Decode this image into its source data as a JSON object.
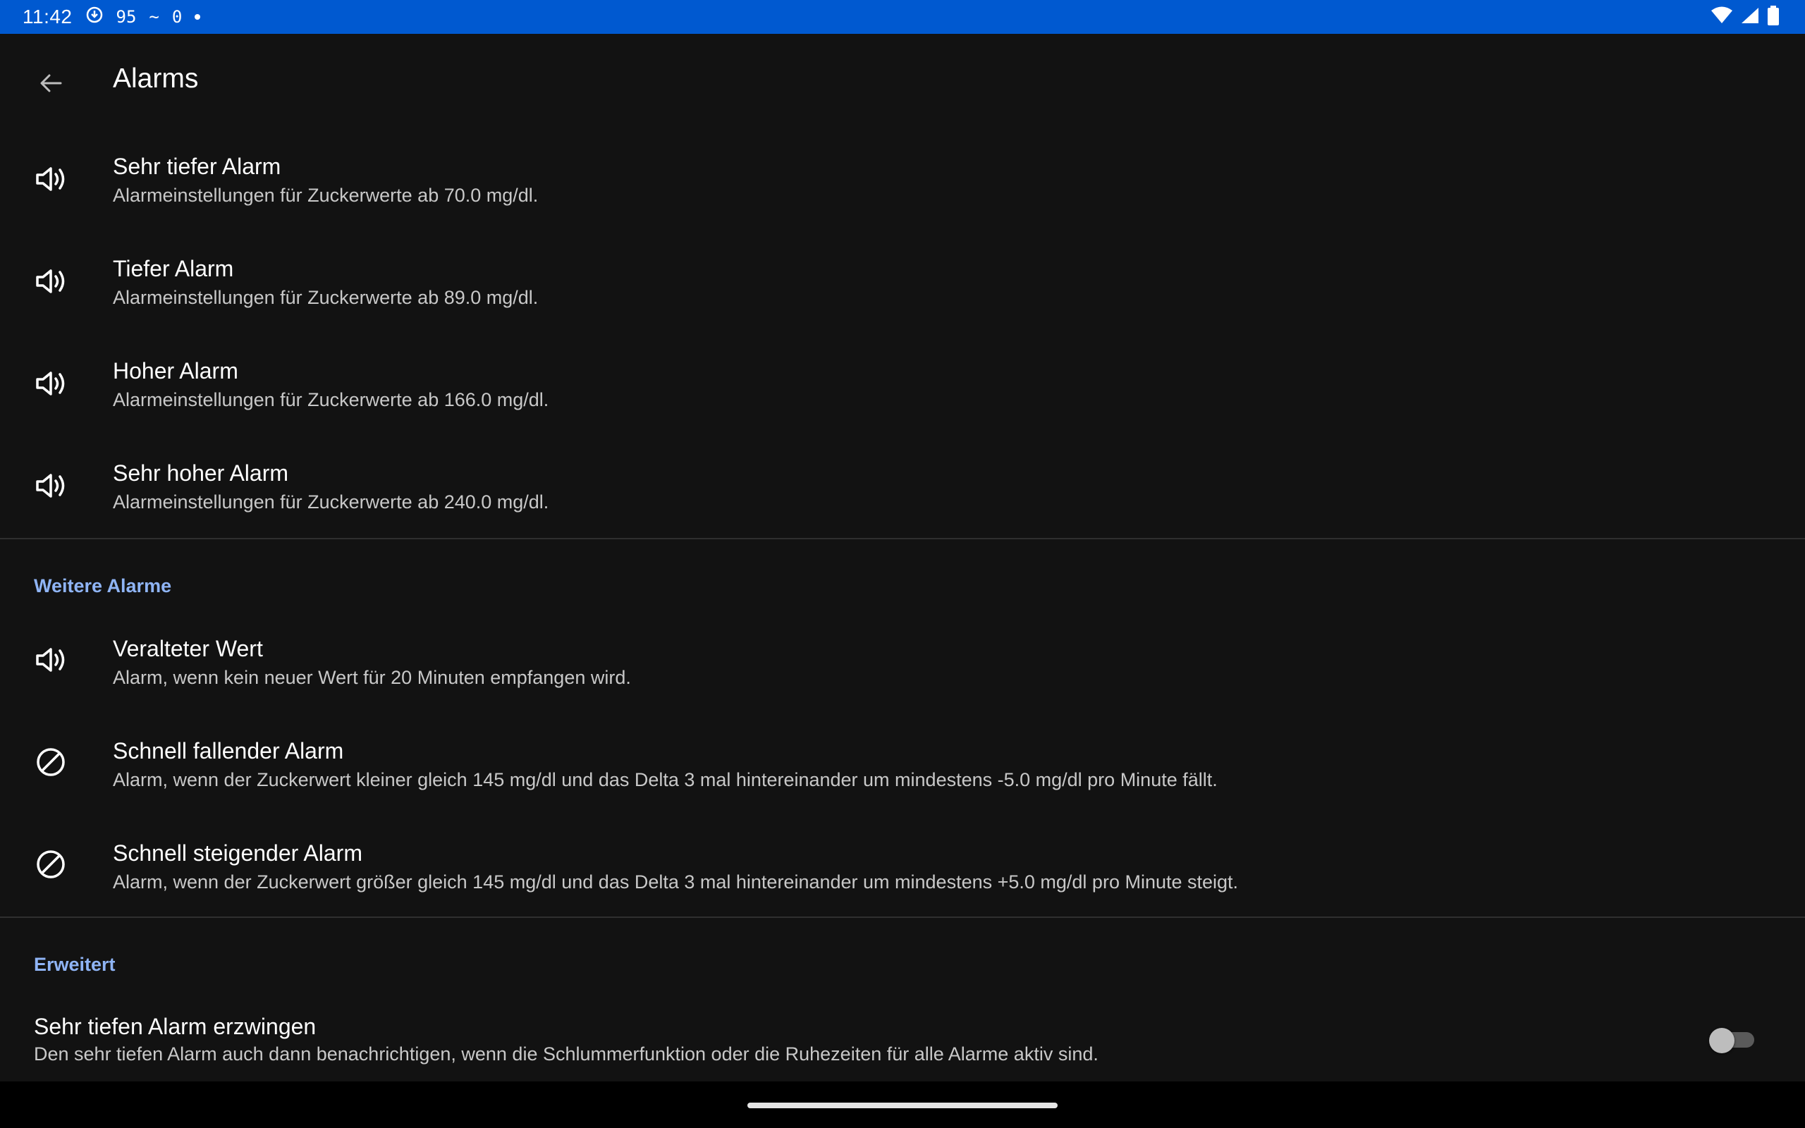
{
  "status_bar": {
    "time": "11:42",
    "indicator_1": "95",
    "indicator_2": "~",
    "indicator_3": "0",
    "icons": [
      "sync-icon",
      "wifi-icon",
      "signal-icon",
      "battery-icon"
    ]
  },
  "app_bar": {
    "title": "Alarms",
    "back_icon": "arrow-back-icon"
  },
  "alarms": [
    {
      "title": "Sehr tiefer Alarm",
      "subtitle": "Alarmeinstellungen für Zuckerwerte ab 70.0 mg/dl.",
      "icon": "volume-icon"
    },
    {
      "title": "Tiefer Alarm",
      "subtitle": "Alarmeinstellungen für Zuckerwerte ab 89.0 mg/dl.",
      "icon": "volume-icon"
    },
    {
      "title": "Hoher Alarm",
      "subtitle": "Alarmeinstellungen für Zuckerwerte ab 166.0 mg/dl.",
      "icon": "volume-icon"
    },
    {
      "title": "Sehr hoher Alarm",
      "subtitle": "Alarmeinstellungen für Zuckerwerte ab 240.0 mg/dl.",
      "icon": "volume-icon"
    }
  ],
  "further_section": {
    "header": "Weitere Alarme",
    "items": [
      {
        "title": "Veralteter Wert",
        "subtitle": "Alarm, wenn kein neuer Wert für 20 Minuten empfangen wird.",
        "icon": "volume-icon"
      },
      {
        "title": "Schnell fallender Alarm",
        "subtitle": "Alarm, wenn der Zuckerwert kleiner gleich 145 mg/dl und das Delta 3 mal hintereinander um mindestens -5.0 mg/dl pro Minute fällt.",
        "icon": "blocked-icon"
      },
      {
        "title": "Schnell steigender Alarm",
        "subtitle": "Alarm, wenn der Zuckerwert größer gleich 145 mg/dl und das Delta 3 mal hintereinander um mindestens +5.0 mg/dl pro Minute steigt.",
        "icon": "blocked-icon"
      }
    ]
  },
  "advanced_section": {
    "header": "Erweitert",
    "item": {
      "title": "Sehr tiefen Alarm erzwingen",
      "subtitle": "Den sehr tiefen Alarm auch dann benachrichtigen, wenn die Schlummerfunktion oder die Ruhezeiten für alle Alarme aktiv sind.",
      "toggle_on": false
    }
  },
  "colors": {
    "status_bar": "#0059d0",
    "background": "#121212",
    "section_header": "#8fb4f5",
    "divider": "#2f2f2f"
  }
}
